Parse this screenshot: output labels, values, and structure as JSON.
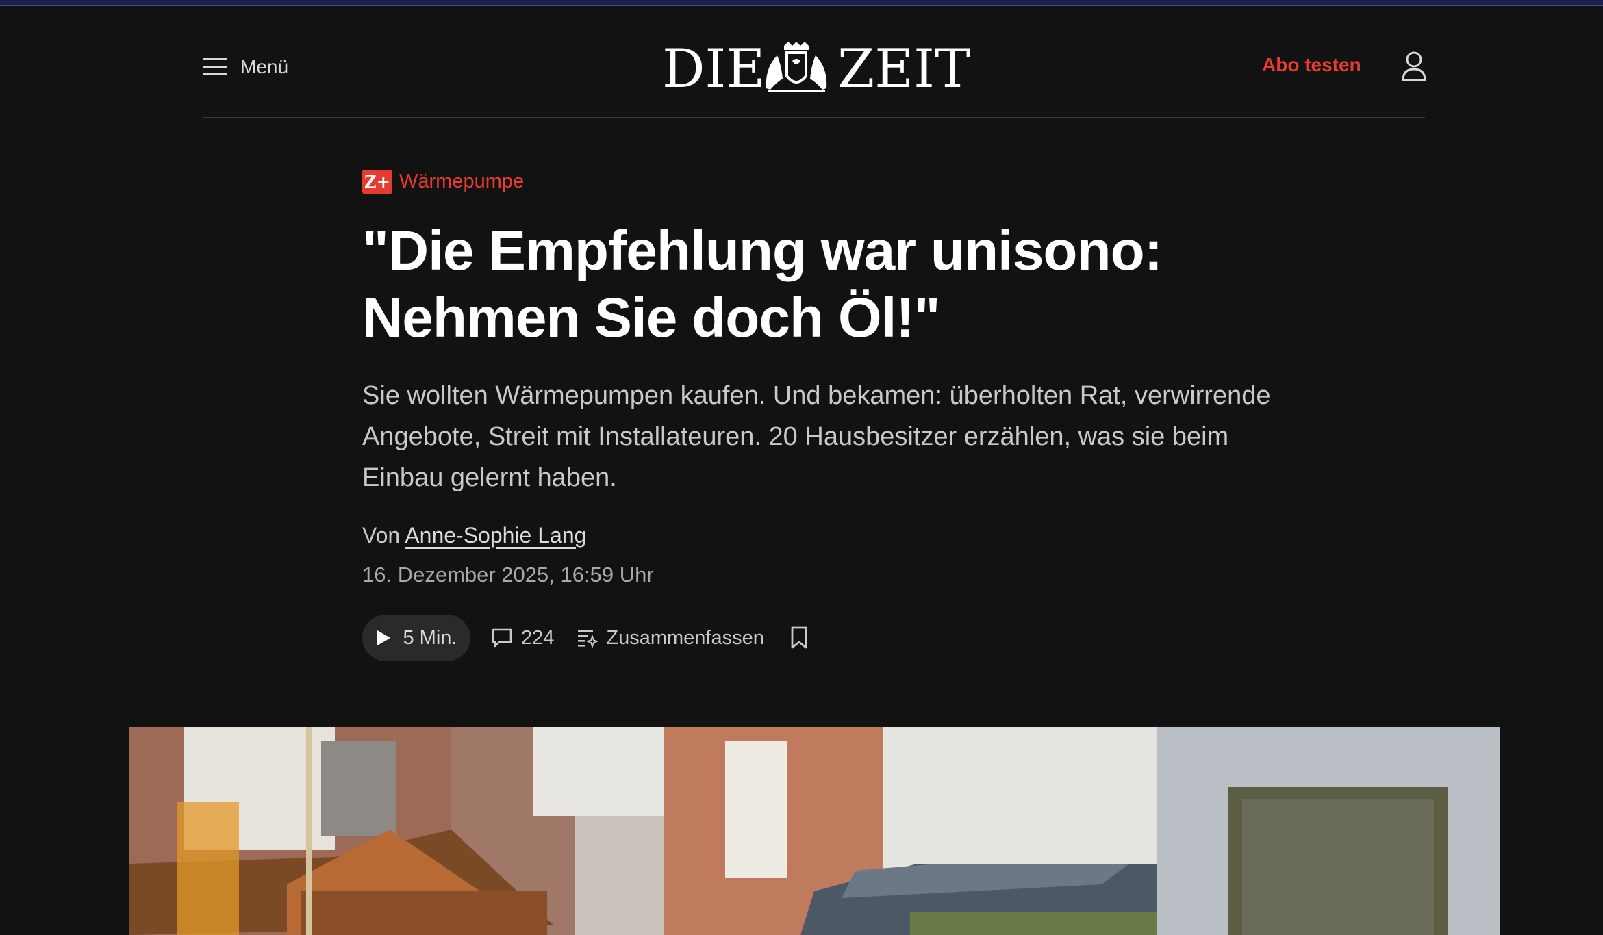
{
  "header": {
    "menu_label": "Menü",
    "logo_left": "DIE",
    "logo_right": "ZEIT",
    "abo_label": "Abo testen"
  },
  "article": {
    "badge": "Z+",
    "kicker": "Wärmepumpe",
    "headline_line1": "\"Die Empfehlung war unisono:",
    "headline_line2": "Nehmen Sie doch Öl!\"",
    "summary": "Sie wollten Wärmepumpen kaufen. Und bekamen: überholten Rat, verwirrende Angebote, Streit mit Installateuren. 20 Hausbesitzer erzählen, was sie beim Einbau gelernt haben.",
    "byline_prefix": "Von",
    "author": "Anne-Sophie Lang",
    "date": "16. Dezember 2025, 16:59 Uhr"
  },
  "actions": {
    "audio_label": "5 Min.",
    "comments_count": "224",
    "summarize_label": "Zusammenfassen"
  },
  "icons": {
    "menu": "hamburger-menu-icon",
    "account": "user-icon",
    "play": "play-icon",
    "comments": "speech-bubble-icon",
    "summarize": "text-sparkle-icon",
    "bookmark": "bookmark-icon"
  },
  "colors": {
    "background": "#121212",
    "accent": "#e63b2e",
    "text": "#ffffff",
    "muted": "#c9c9c9"
  }
}
